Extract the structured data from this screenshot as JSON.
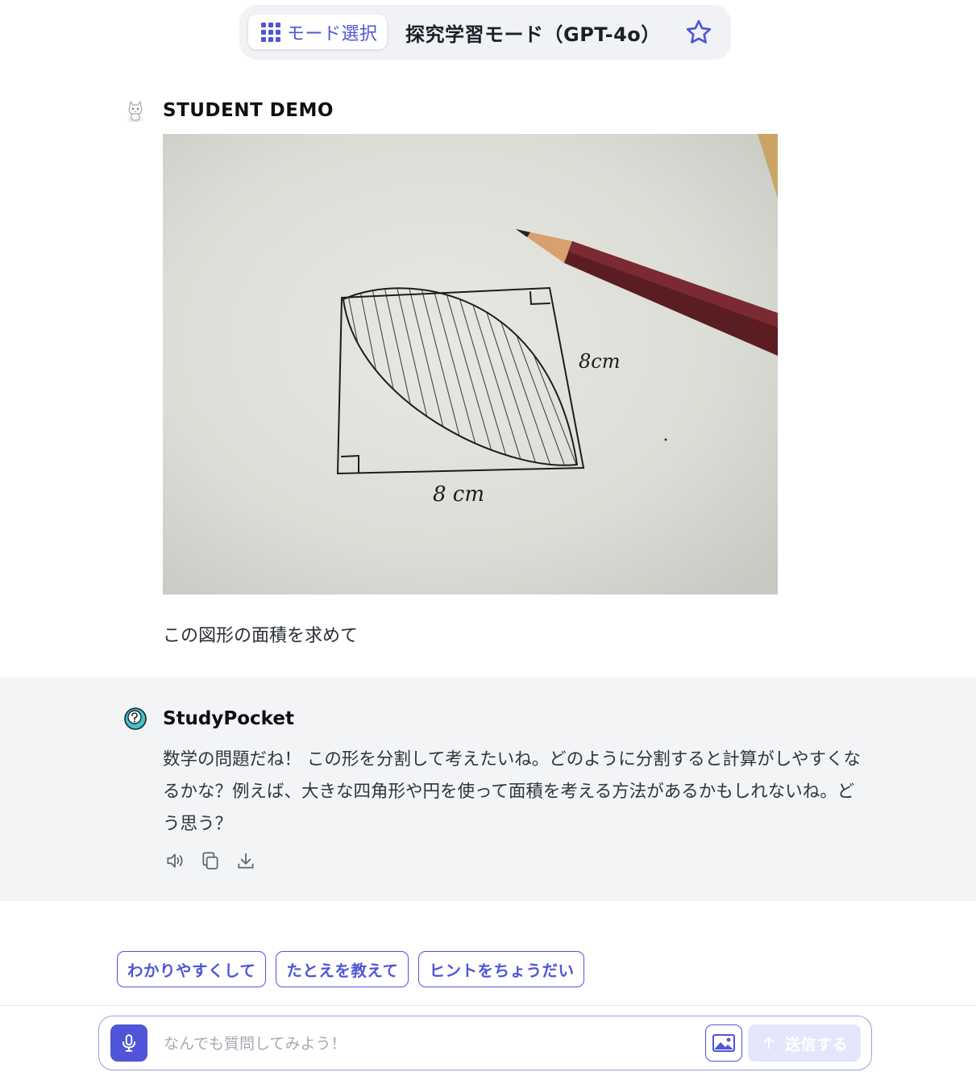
{
  "header": {
    "mode_select_label": "モード選択",
    "mode_title": "探究学習モード（GPT-4o）",
    "accent_color": "#4f55d6"
  },
  "student_message": {
    "author": "STUDENT DEMO",
    "text": "この図形の面積を求めて",
    "photo_labels": {
      "right_side": "8cm",
      "bottom_side": "8 cm"
    }
  },
  "assistant_message": {
    "author": "StudyPocket",
    "text": "数学の問題だね！ この形を分割して考えたいね。どのように分割すると計算がしやすくなるかな？例えば、大きな四角形や円を使って面積を考える方法があるかもしれないね。どう思う？",
    "actions": [
      "speaker-icon",
      "copy-icon",
      "download-icon"
    ]
  },
  "quick_replies": [
    "わかりやすくして",
    "たとえを教えて",
    "ヒントをちょうだい"
  ],
  "composer": {
    "placeholder": "なんでも質問してみよう！",
    "send_label": "送信する"
  }
}
